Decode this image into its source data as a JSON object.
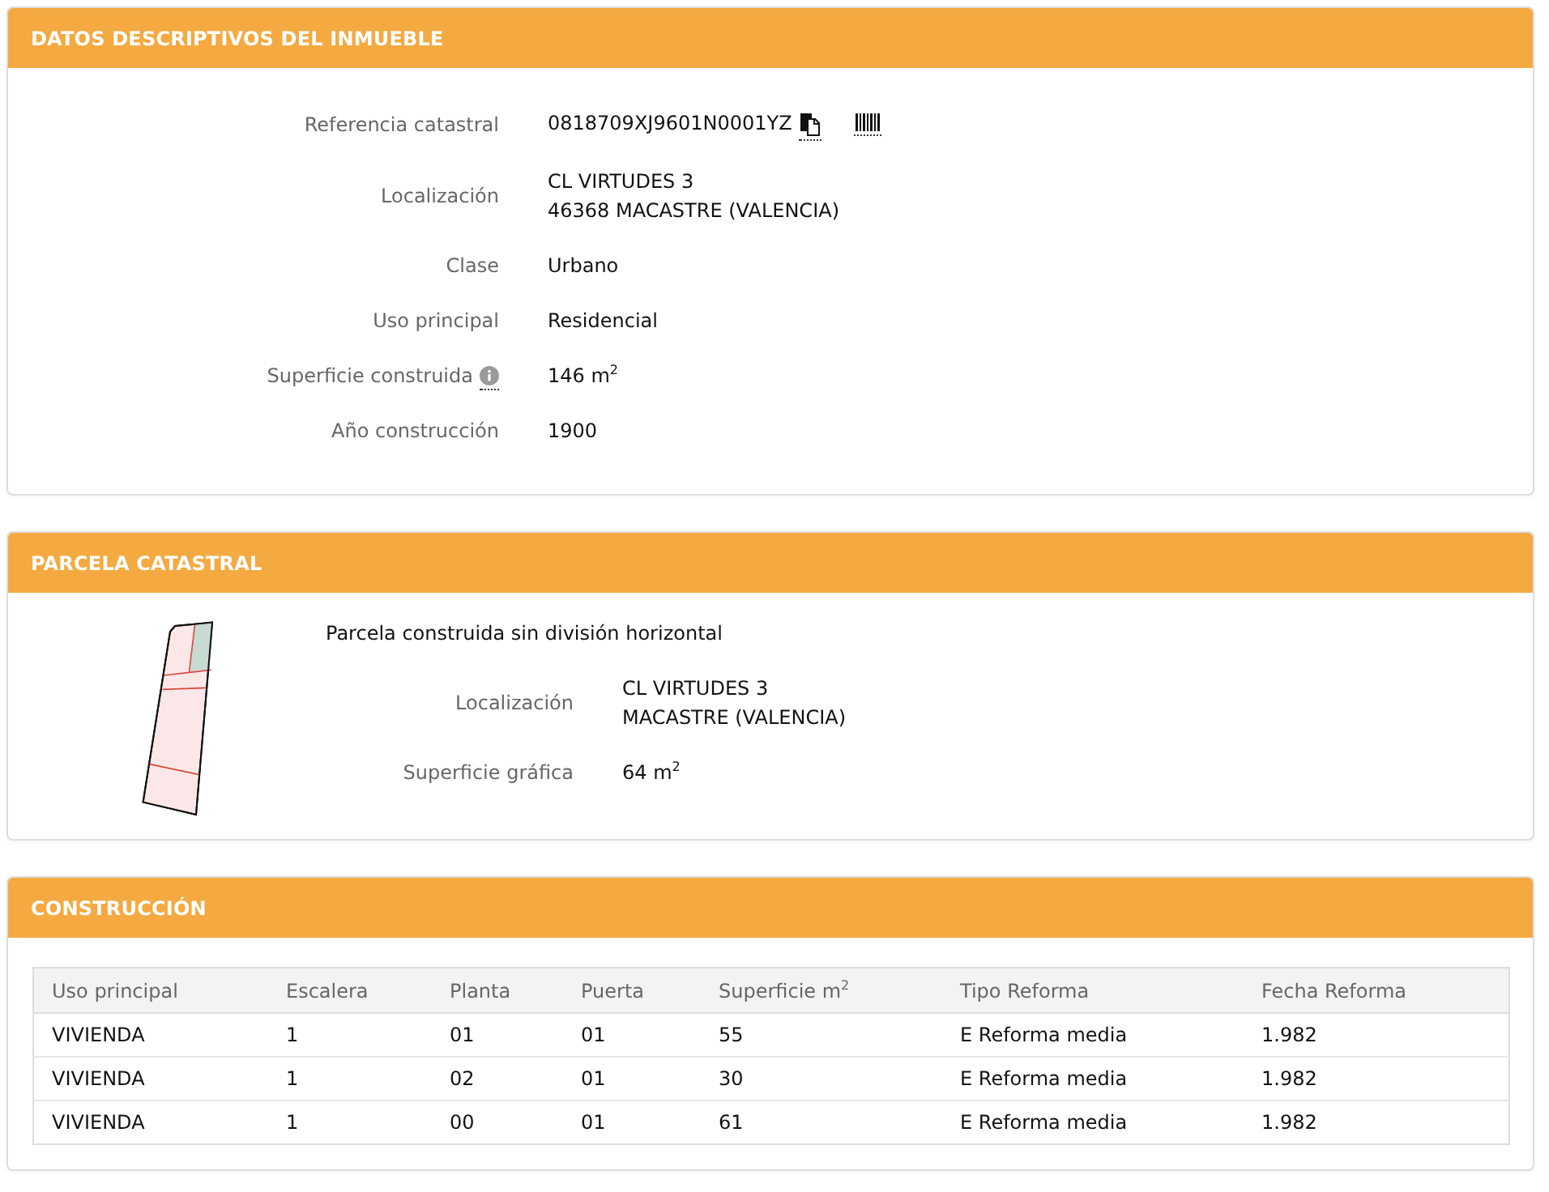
{
  "property_details": {
    "title": "DATOS DESCRIPTIVOS DEL INMUEBLE",
    "fields": [
      {
        "kind": "reference",
        "label": "Referencia catastral",
        "lines": [
          "0818709XJ9601N0001YZ"
        ]
      },
      {
        "kind": "plain",
        "label": "Localización",
        "lines": [
          "CL VIRTUDES 3",
          "46368 MACASTRE (VALENCIA)"
        ]
      },
      {
        "kind": "plain",
        "label": "Clase",
        "lines": [
          "Urbano"
        ]
      },
      {
        "kind": "plain",
        "label": "Uso principal",
        "lines": [
          "Residencial"
        ]
      },
      {
        "kind": "info",
        "label": "Superficie construida",
        "lines": [
          "146 m$^{2}$"
        ]
      },
      {
        "kind": "plain",
        "label": "Año construcción",
        "lines": [
          "1900"
        ]
      }
    ]
  },
  "parcel": {
    "title": "PARCELA CATASTRAL",
    "description": "Parcela construida sin división horizontal",
    "fields": [
      {
        "label": "Localización",
        "lines": [
          "CL VIRTUDES 3",
          "MACASTRE (VALENCIA)"
        ]
      },
      {
        "label": "Superficie gráfica",
        "lines": [
          "64 m$^{2}$"
        ]
      }
    ]
  },
  "construction": {
    "title": "CONSTRUCCIÓN",
    "table": {
      "columns": [
        "Uso principal",
        "Escalera",
        "Planta",
        "Puerta",
        "Superficie m$^{2}$",
        "Tipo Reforma",
        "Fecha Reforma"
      ],
      "rows": [
        [
          "VIVIENDA",
          "1",
          "01",
          "01",
          "55",
          "E Reforma media",
          "1.982"
        ],
        [
          "VIVIENDA",
          "1",
          "02",
          "01",
          "30",
          "E Reforma media",
          "1.982"
        ],
        [
          "VIVIENDA",
          "1",
          "00",
          "01",
          "61",
          "E Reforma media",
          "1.982"
        ]
      ]
    }
  }
}
